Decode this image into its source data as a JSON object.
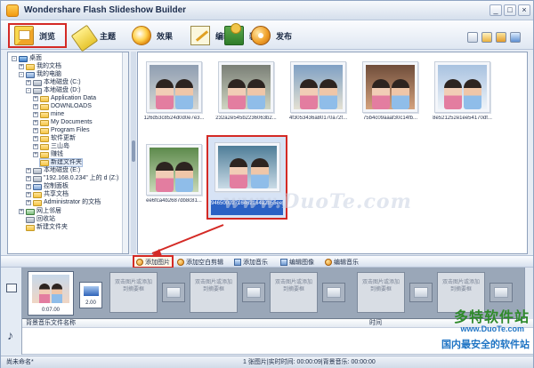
{
  "window": {
    "title": "Wondershare  Flash Slideshow Builder",
    "min": "_",
    "max": "□",
    "close": "×"
  },
  "toolbar": {
    "tabs": [
      {
        "label": "浏览",
        "icon": "folder-photo-icon",
        "active": true
      },
      {
        "label": "主题",
        "icon": "pencil-icon"
      },
      {
        "label": "效果",
        "icon": "star-effect-icon"
      },
      {
        "label": "编辑",
        "icon": "edit-icon"
      },
      {
        "label": "装饰",
        "icon": "decoration-icon"
      },
      {
        "label": "发布",
        "icon": "publish-icon"
      }
    ]
  },
  "tree": {
    "items": [
      {
        "label": "桌面",
        "icon": "desktop-icon"
      },
      {
        "label": "我的文档",
        "icon": "folder-icon"
      },
      {
        "label": "我的电脑",
        "icon": "computer-icon"
      },
      {
        "label": "本地磁盘 (C:)",
        "icon": "drive-icon"
      },
      {
        "label": "本地磁盘 (D:)",
        "icon": "drive-icon"
      },
      {
        "label": "Application Data",
        "icon": "folder-icon"
      },
      {
        "label": "DOWNLOADS",
        "icon": "folder-icon"
      },
      {
        "label": "mine",
        "icon": "folder-icon"
      },
      {
        "label": "My Documents",
        "icon": "folder-icon"
      },
      {
        "label": "Program Files",
        "icon": "folder-icon"
      },
      {
        "label": "软件更新",
        "icon": "folder-icon"
      },
      {
        "label": "三山岛",
        "icon": "folder-icon"
      },
      {
        "label": "赚钱",
        "icon": "folder-icon"
      },
      {
        "label": "新建文件夹",
        "icon": "folder-icon",
        "selected": true
      },
      {
        "label": "本地磁盘 (E:)",
        "icon": "drive-icon"
      },
      {
        "label": "\"192.168.0.234\" 上的 d (Z:)",
        "icon": "network-drive-icon"
      },
      {
        "label": "控制面板",
        "icon": "control-panel-icon"
      },
      {
        "label": "共享文档",
        "icon": "folder-icon"
      },
      {
        "label": "Administrator 的文档",
        "icon": "folder-icon"
      },
      {
        "label": "网上邻居",
        "icon": "network-icon"
      },
      {
        "label": "回收站",
        "icon": "recycle-bin-icon"
      },
      {
        "label": "新建文件夹",
        "icon": "folder-icon"
      }
    ]
  },
  "thumbs": {
    "items": [
      {
        "caption": "126d53c8524d0d0e7e3..."
      },
      {
        "caption": "232a2e545b2236063b2..."
      },
      {
        "caption": "4f3053436a80170a72f..."
      },
      {
        "caption": "75b4c09aaaf30c14fb..."
      },
      {
        "caption": "8e521252e1ee54170df..."
      },
      {
        "caption": "ee6fca4b2687db8c81..."
      }
    ],
    "selected_caption": "94650002716462164a2b55ee[1].jpg",
    "watermark": "www.DuoTe.com"
  },
  "clipbar": {
    "add_photo": "添加图片",
    "add_blank": "添加空白剪辑",
    "add_music": "添加音乐",
    "edit_photo": "编辑图像",
    "edit_music": "编辑音乐"
  },
  "timeline": {
    "first_clip_time": "0:07.00",
    "transition_time": "2.00",
    "placeholder": "双击图片或添加到摘要框"
  },
  "music": {
    "col_name": "背景音乐文件名称",
    "col_time": "时间"
  },
  "status": {
    "left": "尚未命名*",
    "right": "1 张图片|实时时间: 00:00:09|背景音乐: 00:00:00"
  },
  "brand": {
    "name": "多特软件站",
    "url": "www.DuoTe.com",
    "slogan": "国内最安全的软件站"
  },
  "colors": {
    "highlight": "#d42a25",
    "selection": "#2a61c4"
  }
}
